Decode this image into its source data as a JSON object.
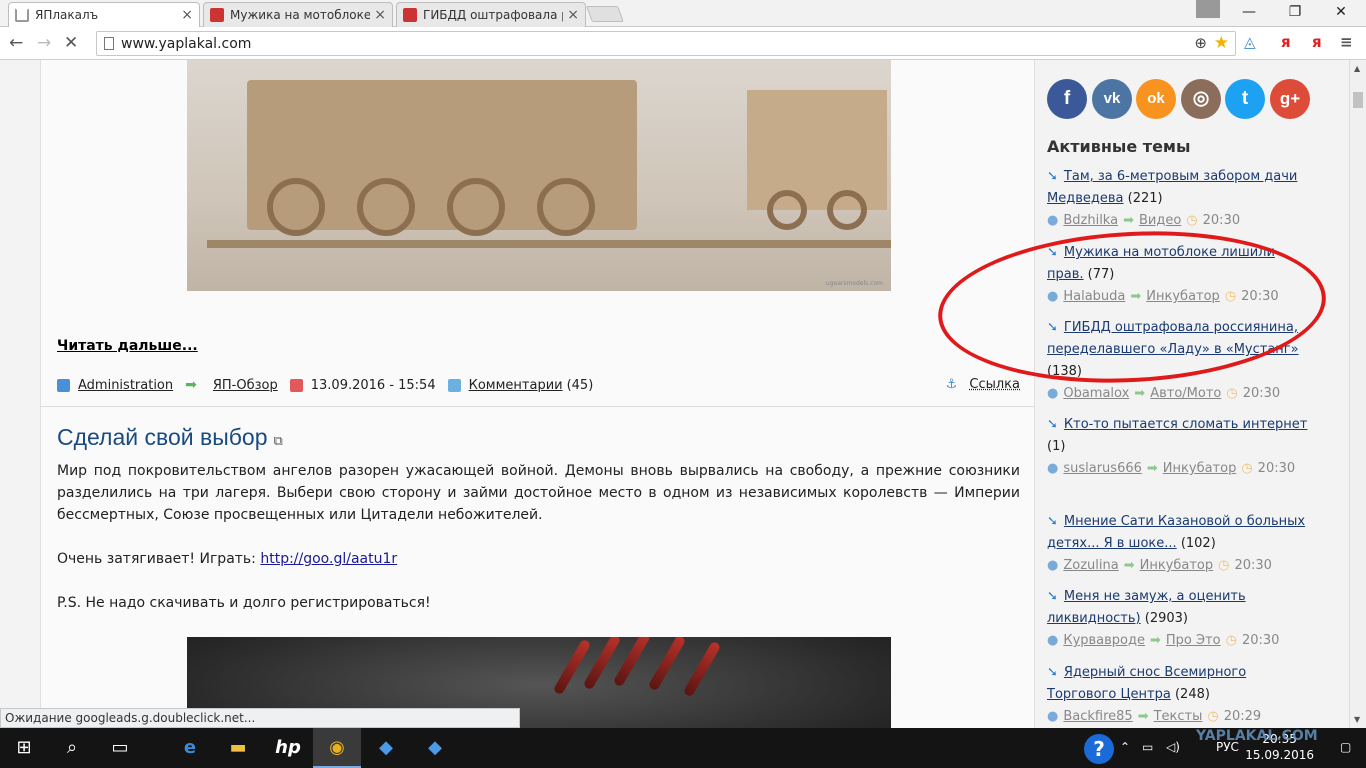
{
  "browser": {
    "tabs": [
      {
        "title": "ЯПлакалъ",
        "close": "×"
      },
      {
        "title": "Мужика на мотоблоке лишили прав",
        "close": "×"
      },
      {
        "title": "ГИБДД оштрафовала россиянина",
        "close": "×"
      }
    ],
    "window": {
      "minimize": "—",
      "maximize": "❐",
      "close": "✕"
    },
    "url": "www.yaplakal.com",
    "ext_ya1": "я",
    "ext_ya2": "я"
  },
  "post1": {
    "image_caption": "ugearsmodels.com",
    "read_more": "Читать дальше...",
    "author": "Administration",
    "section": "ЯП-Обзор",
    "date": "13.09.2016 - 15:54",
    "comments_label": "Комментарии",
    "comments_count": "(45)",
    "link_label": "Ссылка"
  },
  "post2": {
    "title": "Сделай свой выбор",
    "paragraph1": "Мир под покровительством ангелов разорен ужасающей войной. Демоны вновь вырвались на свободу, а прежние союзники разделились на три лагеря. Выбери свою сторону и займи достойное место в одном из независимых королевств — Империи бессмертных, Союзе просвещенных или Цитадели небожителей.",
    "paragraph2_text": "Очень затягивает! Играть: ",
    "paragraph2_link": "http://goo.gl/aatu1r",
    "paragraph3": "P.S. Не надо скачивать и долго регистрироваться!"
  },
  "sidebar": {
    "social": [
      {
        "name": "facebook",
        "glyph": "f",
        "color": "#3b5998"
      },
      {
        "name": "vk",
        "glyph": "vk",
        "color": "#4c75a3"
      },
      {
        "name": "odnoklassniki",
        "glyph": "ok",
        "color": "#f7931e"
      },
      {
        "name": "instagram",
        "glyph": "◎",
        "color": "#8a6d5b"
      },
      {
        "name": "twitter",
        "glyph": "t",
        "color": "#1da1f2"
      },
      {
        "name": "google-plus",
        "glyph": "g+",
        "color": "#dd4b39"
      }
    ],
    "title": "Активные темы",
    "topics": [
      {
        "title": "Там, за 6-метровым забором дачи Медведева",
        "count": "(221)",
        "user": "Bdzhilka",
        "section": "Видео",
        "time": "20:30"
      },
      {
        "title": "Мужика на мотоблоке лишили прав.",
        "count": "(77)",
        "user": "Halabuda",
        "section": "Инкубатор",
        "time": "20:30"
      },
      {
        "title": "ГИБДД оштрафовала россиянина, переделавшего «Ладу» в «Мустанг»",
        "count": "(138)",
        "user": "Obamalox",
        "section": "Авто/Мото",
        "time": "20:30"
      },
      {
        "title": "Кто-то пытается сломать интернет",
        "count": "(1)",
        "user": "suslarus666",
        "section": "Инкубатор",
        "time": "20:30"
      },
      {
        "title": "Мнение Сати Казановой о больных детях... Я в шоке...",
        "count": "(102)",
        "user": "Zozulina",
        "section": "Инкубатор",
        "time": "20:30"
      },
      {
        "title": "Меня не замуж, а оценить ликвидность)",
        "count": "(2903)",
        "user": "Курвавроде",
        "section": "Про Это",
        "time": "20:30"
      },
      {
        "title": "Ядерный снос Всемирного Торгового Центра",
        "count": "(248)",
        "user": "Backfire85",
        "section": "Тексты",
        "time": "20:29"
      }
    ]
  },
  "status_text": "Ожидание googleads.g.doubleclick.net...",
  "taskbar": {
    "lang": "РУС",
    "time": "20:35",
    "date": "15.09.2016",
    "help": "?",
    "watermark": "YAPLAKAL.COM"
  }
}
